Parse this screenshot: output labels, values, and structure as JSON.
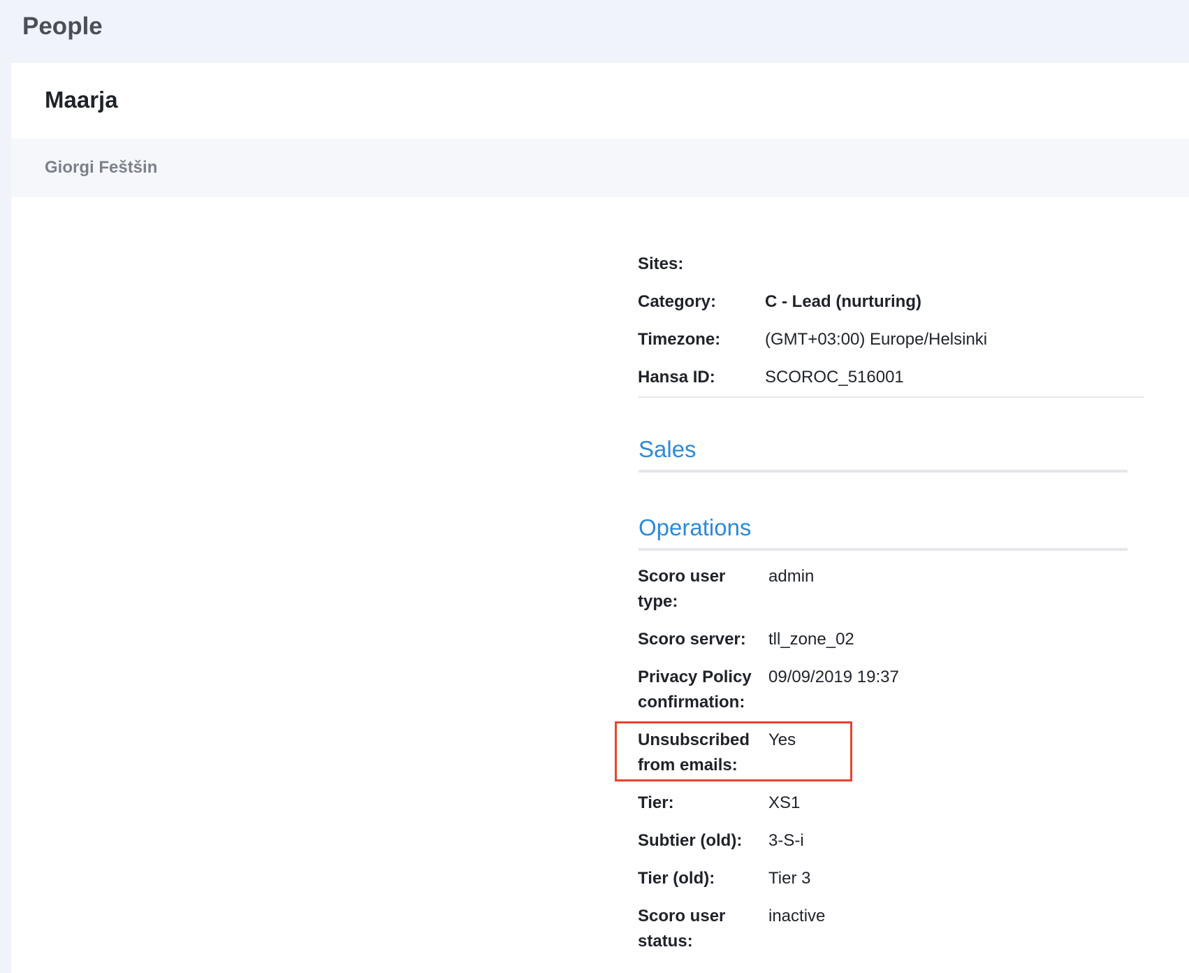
{
  "header": {
    "title": "People"
  },
  "card": {
    "title": "Maarja",
    "owner": "Giorgi Feštšin"
  },
  "general": [
    {
      "label": "Sites:",
      "value": ""
    },
    {
      "label": "Category:",
      "value": "C - Lead (nurturing)"
    },
    {
      "label": "Timezone:",
      "value": "(GMT+03:00) Europe/Helsinki"
    },
    {
      "label": "Hansa ID:",
      "value": "SCOROC_516001"
    }
  ],
  "sections": {
    "sales": "Sales",
    "operations": "Operations"
  },
  "operations": {
    "scoro_user_type": {
      "label1": "Scoro user",
      "label2": "type:",
      "value": "admin"
    },
    "scoro_server": {
      "label": "Scoro server:",
      "value": "tll_zone_02"
    },
    "privacy_policy": {
      "label1": "Privacy Policy",
      "label2": "confirmation:",
      "value": "09/09/2019 19:37"
    },
    "unsubscribed": {
      "label1": "Unsubscribed",
      "label2": "from emails:",
      "value": "Yes"
    },
    "tier": {
      "label": "Tier:",
      "value": "XS1"
    },
    "subtier_old": {
      "label": "Subtier (old):",
      "value": "3-S-i"
    },
    "tier_old": {
      "label": "Tier (old):",
      "value": "Tier 3"
    },
    "scoro_user_status": {
      "label1": "Scoro user",
      "label2": "status:",
      "value": "inactive"
    }
  },
  "colors": {
    "accent": "#2d8ad6",
    "highlight": "#e8432e"
  }
}
